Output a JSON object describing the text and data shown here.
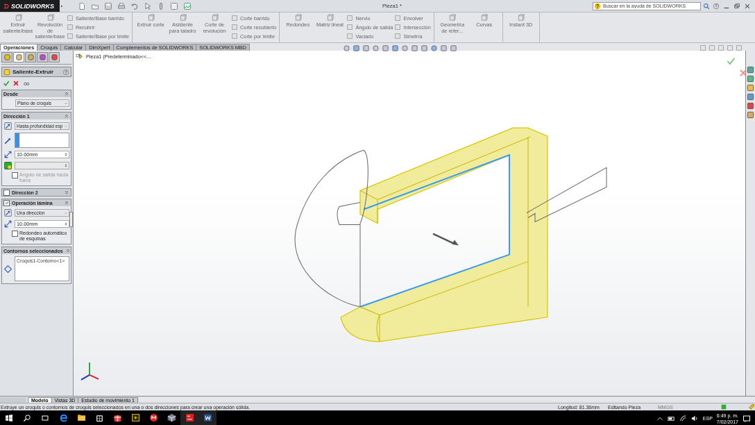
{
  "app": {
    "logo": "SOLIDWORKS",
    "title": "Pieza1 *",
    "search": {
      "placeholder": "Buscar en la ayuda de SOLIDWORKS"
    }
  },
  "ribbon": {
    "groups": [
      {
        "large": [
          "Extruir saliente/base",
          "Revolución de saliente/base"
        ],
        "columns": [
          [
            "Saliente/Base barrido",
            "Recubrir",
            "Saliente/Base por límite"
          ]
        ]
      },
      {
        "large": [
          "Extruir corte",
          "Asistente para taladro",
          "Corte de revolución"
        ],
        "columns": [
          [
            "Corte barrido",
            "Corte recubierto",
            "Corte por límite"
          ]
        ]
      },
      {
        "large": [
          "Redondeo",
          "Matriz lineal"
        ],
        "columns": [
          [
            "Nervio",
            "Ángulo de salida",
            "Vaciado"
          ],
          [
            "Envolver",
            "Intersección",
            "Simetría"
          ]
        ]
      },
      {
        "large": [
          "Geometría de refer...",
          "Curvas"
        ]
      },
      {
        "large": [
          "Instant 3D"
        ]
      }
    ]
  },
  "command_tabs": [
    {
      "label": "Operaciones",
      "selected": true
    },
    {
      "label": "Croquis",
      "selected": false
    },
    {
      "label": "Calcular",
      "selected": false
    },
    {
      "label": "DimXpert",
      "selected": false
    },
    {
      "label": "Complementos de SOLIDWORKS",
      "selected": false
    },
    {
      "label": "SOLIDWORKS MBD",
      "selected": false
    }
  ],
  "panel_tabs": [
    {
      "selected": false
    },
    {
      "selected": true
    },
    {
      "selected": false
    },
    {
      "selected": false
    },
    {
      "selected": false
    }
  ],
  "property_manager": {
    "title": "Saliente-Extruir",
    "sections": [
      {
        "title": "Desde",
        "kind": "plain",
        "expanded": true,
        "rows": [
          {
            "kind": "dropdown",
            "value": "Plano de croquis"
          }
        ]
      },
      {
        "title": "Dirección 1",
        "kind": "plain",
        "expanded": true,
        "rows": [
          {
            "kind": "icon-dropdown",
            "value": "Hasta profundidad esp"
          },
          {
            "kind": "selection",
            "active": true
          },
          {
            "kind": "spinner",
            "value": "10.00mm",
            "disabled": false
          },
          {
            "kind": "spinner",
            "disabled": true
          },
          {
            "kind": "checkbox",
            "label": "Ángulo de salida hacia fuera",
            "checked": false,
            "disabled": true
          }
        ]
      },
      {
        "title": "Dirección 2",
        "kind": "toggle",
        "checked": false,
        "expanded": false
      },
      {
        "title": "Operación lámina",
        "kind": "toggle",
        "checked": true,
        "expanded": true,
        "rows": [
          {
            "kind": "icon-dropdown",
            "value": "Una dirección"
          },
          {
            "kind": "spinner",
            "value": "10.00mm",
            "disabled": false
          },
          {
            "kind": "checkbox",
            "label": "Redondeo automático de esquinas",
            "checked": false,
            "disabled": false
          }
        ]
      },
      {
        "title": "Contornos seleccionados",
        "kind": "plain",
        "expanded": true,
        "rows": [
          {
            "kind": "list",
            "items": [
              "Croquis1-Contorno<1>"
            ]
          }
        ]
      }
    ]
  },
  "feature_tree": {
    "root": "Pieza1  (Predeterminado<<..."
  },
  "bottom_tabs": [
    {
      "label": "Modelo",
      "selected": true
    },
    {
      "label": "Vistas 3D",
      "selected": false
    },
    {
      "label": "Estudio de movimiento 1",
      "selected": false
    }
  ],
  "status_bar": {
    "message": "Extruye un croquis o contornos de croquis seleccionados en una o dos direcciones para crear una operación sólida.",
    "measure": "Longitud: 81.36mm",
    "mode": "Editando Pieza",
    "units": "MMGS"
  },
  "taskbar": {
    "apps": [
      {
        "running": false
      },
      {
        "running": false
      },
      {
        "running": false
      },
      {
        "running": false
      },
      {
        "running": false
      },
      {
        "running": false
      },
      {
        "running": false
      },
      {
        "running": true
      },
      {
        "running": true
      }
    ],
    "language": "ESP",
    "time": "6:49 p. m.",
    "date": "7/02/2017"
  }
}
